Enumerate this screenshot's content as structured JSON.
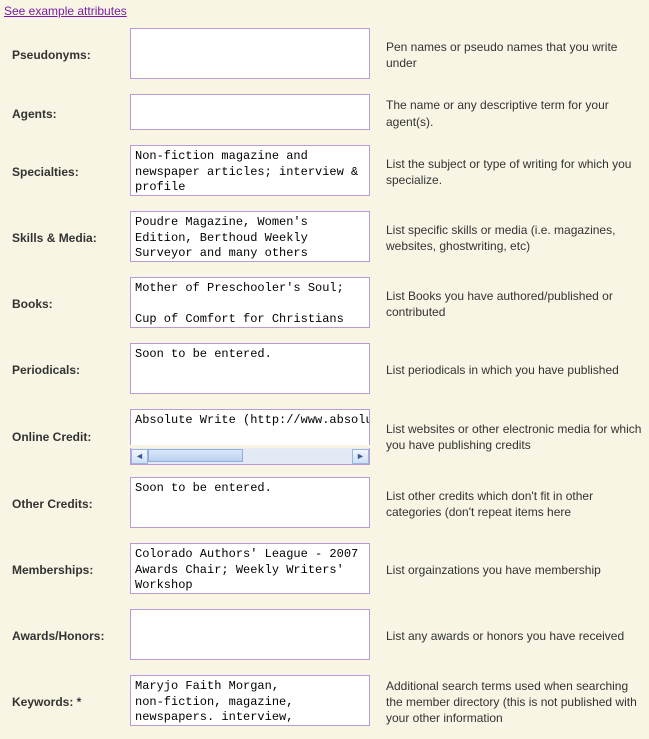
{
  "top_link": "See example attributes",
  "rows": [
    {
      "label": "Pseudonyms:",
      "value": "",
      "hint": "Pen names or pseudo names that you write under",
      "rows": 3,
      "scroll": false
    },
    {
      "label": "Agents:",
      "value": "",
      "hint": "The name or any descriptive term for your agent(s).",
      "rows": 2,
      "scroll": false
    },
    {
      "label": "Specialties:",
      "value": "Non-fiction magazine and newspaper articles; interview & profile",
      "hint": "List the subject or type of writing for which you specialize.",
      "rows": 3,
      "scroll": false
    },
    {
      "label": "Skills & Media:",
      "value": "Poudre Magazine, Women's Edition, Berthoud Weekly Surveyor and many others",
      "hint": "List specific skills or media (i.e. magazines, websites, ghostwriting, etc)",
      "rows": 3,
      "scroll": true
    },
    {
      "label": "Books:",
      "value": "Mother of Preschooler's Soul;\n\nCup of Comfort for Christians",
      "hint": "List Books you have authored/published or contributed",
      "rows": 3,
      "scroll": true
    },
    {
      "label": "Periodicals:",
      "value": "Soon to be entered.",
      "hint": "List periodicals in which you have published",
      "rows": 3,
      "scroll": false
    },
    {
      "label": "Online Credit:",
      "value": "Absolute Write (http://www.absolutewrite.com/fun",
      "hint": "List websites or other electronic media for which you have publishing credits",
      "rows": 2,
      "scroll": false,
      "hscroll": true
    },
    {
      "label": "Other Credits:",
      "value": "Soon to be entered.",
      "hint": "List other credits which don't fit in other categories (don't repeat items here",
      "rows": 3,
      "scroll": false
    },
    {
      "label": "Memberships:",
      "value": "Colorado Authors' League - 2007 Awards Chair; Weekly Writers' Workshop",
      "hint": "List orgainzations you have membership",
      "rows": 3,
      "scroll": false
    },
    {
      "label": "Awards/Honors:",
      "value": "",
      "hint": "List any awards or honors you have received",
      "rows": 3,
      "scroll": false
    },
    {
      "label": "Keywords: *",
      "value": "Maryjo Faith Morgan,\nnon-fiction, magazine, newspapers. interview,",
      "hint": "Additional search terms used when searching the member directory (this is not published with your other information",
      "rows": 3,
      "scroll": true
    }
  ]
}
